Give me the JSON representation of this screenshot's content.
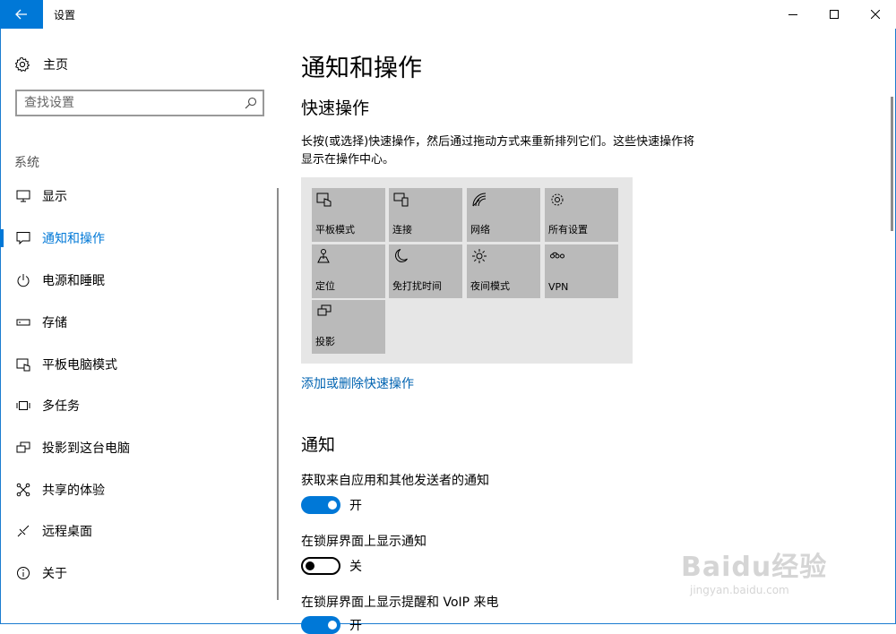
{
  "window": {
    "title": "设置"
  },
  "sidebar": {
    "home_label": "主页",
    "search_placeholder": "查找设置",
    "section_label": "系统",
    "items": [
      {
        "label": "显示",
        "icon": "display-icon"
      },
      {
        "label": "通知和操作",
        "icon": "notification-icon",
        "active": true
      },
      {
        "label": "电源和睡眠",
        "icon": "power-icon"
      },
      {
        "label": "存储",
        "icon": "storage-icon"
      },
      {
        "label": "平板电脑模式",
        "icon": "tablet-mode-icon"
      },
      {
        "label": "多任务",
        "icon": "multitasking-icon"
      },
      {
        "label": "投影到这台电脑",
        "icon": "project-icon"
      },
      {
        "label": "共享的体验",
        "icon": "shared-experiences-icon"
      },
      {
        "label": "远程桌面",
        "icon": "remote-desktop-icon"
      },
      {
        "label": "关于",
        "icon": "info-icon"
      }
    ]
  },
  "main": {
    "title": "通知和操作",
    "quick_actions_title": "快速操作",
    "quick_actions_desc": "长按(或选择)快速操作，然后通过拖动方式来重新排列它们。这些快速操作将显示在操作中心。",
    "tiles": [
      {
        "label": "平板模式",
        "icon": "tablet-mode-icon"
      },
      {
        "label": "连接",
        "icon": "connect-icon"
      },
      {
        "label": "网络",
        "icon": "network-icon"
      },
      {
        "label": "所有设置",
        "icon": "gear-icon"
      },
      {
        "label": "定位",
        "icon": "location-icon"
      },
      {
        "label": "免打扰时间",
        "icon": "moon-icon"
      },
      {
        "label": "夜间模式",
        "icon": "brightness-icon"
      },
      {
        "label": "VPN",
        "icon": "vpn-icon"
      },
      {
        "label": "投影",
        "icon": "project-icon"
      }
    ],
    "add_remove_link": "添加或删除快速操作",
    "notifications_title": "通知",
    "settings": [
      {
        "label": "获取来自应用和其他发送者的通知",
        "state": "开",
        "on": true
      },
      {
        "label": "在锁屏界面上显示通知",
        "state": "关",
        "on": false
      },
      {
        "label": "在锁屏界面上显示提醒和 VoIP 来电",
        "state": "开",
        "on": true
      }
    ]
  },
  "watermark": {
    "brand": "Baidu经验",
    "url": "jingyan.baidu.com"
  },
  "colors": {
    "accent": "#0078d7",
    "link": "#0063b1",
    "tile": "#bababa",
    "panel": "#e6e6e6"
  }
}
